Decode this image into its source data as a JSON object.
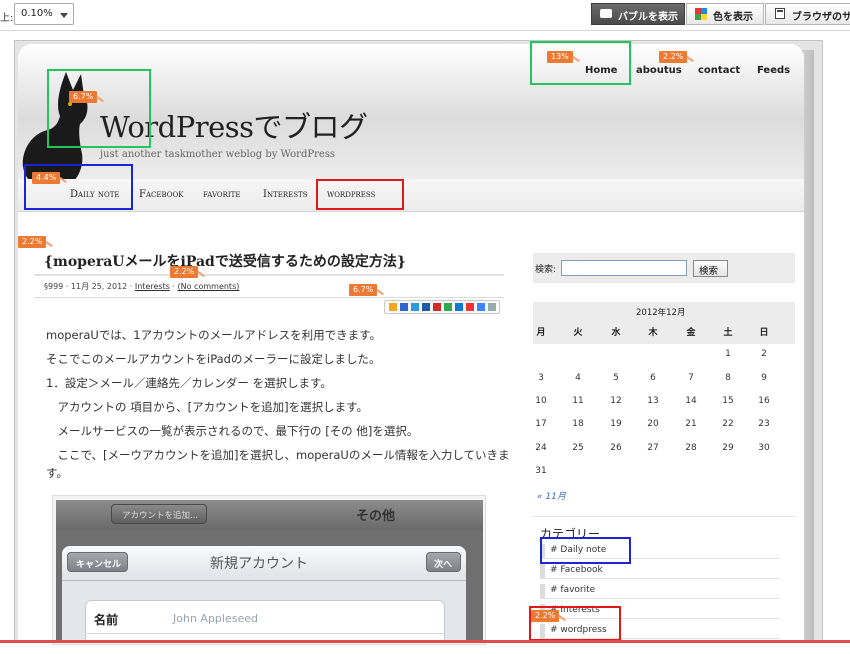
{
  "toolbar": {
    "zoom_label": "上:",
    "zoom_value": "0.10%",
    "bubble_btn": "バブルを表示",
    "color_btn": "色を表示",
    "browser_btn": "ブラウザのサ"
  },
  "site": {
    "title": "WordPressでブログ",
    "tagline": "just another taskmother weblog by WordPress",
    "top_nav": [
      "Home",
      "aboutus",
      "contact",
      "Feeds"
    ],
    "cat_nav": [
      "Daily note",
      "Facebook",
      "favorite",
      "Interests",
      "wordpress"
    ]
  },
  "post": {
    "title": "{moperaUメールをiPadで送受信するための設定方法}",
    "meta_prefix": "§999 · 11月 25, 2012 · ",
    "meta_category": "Interests",
    "meta_sep": " · ",
    "meta_comments": "(No comments)",
    "paragraphs": [
      "moperaUでは、1アカウントのメールアドレスを利用できます。",
      "そこでこのメールアカウントをiPadのメーラーに設定しました。",
      "1．設定＞メール／連絡先／カレンダー を選択します。",
      "　アカウントの 項目から、[アカウントを追加]を選択します。",
      "　メールサービスの一覧が表示されるので、最下行の [その 他]を選択。",
      "　ここで、[メーウアカウントを追加]を選択し、moperaUのメール情報を入力していきま",
      "す。"
    ]
  },
  "ipad": {
    "back_btn": "アカウントを追加...",
    "nav_title": "その他",
    "cancel": "キャンセル",
    "modal_title": "新規アカウント",
    "next": "次へ",
    "row_label": "名前",
    "row_placeholder": "John Appleseed"
  },
  "sidebar": {
    "search_label": "検索:",
    "search_button": "検索",
    "calendar": {
      "caption": "2012年12月",
      "weekdays": [
        "月",
        "火",
        "水",
        "木",
        "金",
        "土",
        "日"
      ],
      "weeks": [
        [
          "",
          "",
          "",
          "",
          "",
          "1",
          "2"
        ],
        [
          "3",
          "4",
          "5",
          "6",
          "7",
          "8",
          "9"
        ],
        [
          "10",
          "11",
          "12",
          "13",
          "14",
          "15",
          "16"
        ],
        [
          "17",
          "18",
          "19",
          "20",
          "21",
          "22",
          "23"
        ],
        [
          "24",
          "25",
          "26",
          "27",
          "28",
          "29",
          "30"
        ],
        [
          "31",
          "",
          "",
          "",
          "",
          "",
          ""
        ]
      ],
      "prev": "« 11月"
    },
    "categories_title": "カテゴリー",
    "categories": [
      "# Daily note",
      "# Facebook",
      "# favorite",
      "# Interests",
      "# wordpress"
    ]
  },
  "overlay": {
    "colors": {
      "green": "#22c55e",
      "blue": "#1d24d6",
      "red": "#e01818",
      "badge": "#ec7a32"
    },
    "badges": [
      "13%",
      "2.2%",
      "6.7%",
      "4.4%",
      "2.2%",
      "2.2%",
      "6.7%",
      "2.2%"
    ]
  }
}
